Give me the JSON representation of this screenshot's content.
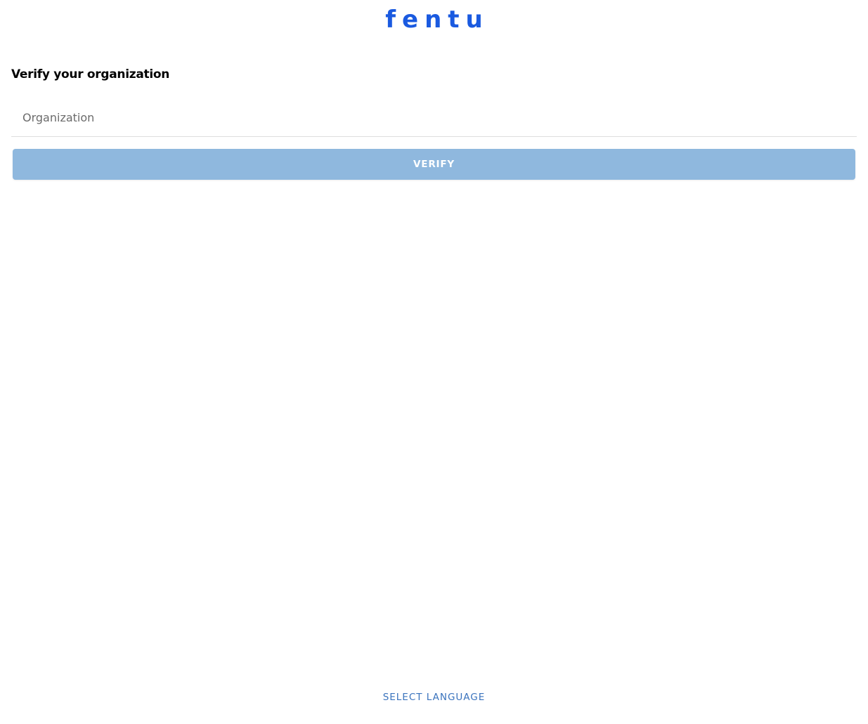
{
  "brand": {
    "logo_text": "fentu",
    "logo_color": "#1a5ae0"
  },
  "form": {
    "title": "Verify your organization",
    "organization_placeholder": "Organization",
    "organization_value": "",
    "verify_label": "VERIFY",
    "verify_button_color": "#8fb8de",
    "verify_enabled": false
  },
  "footer": {
    "select_language_label": "SELECT LANGUAGE",
    "link_color": "#3a73bd"
  }
}
